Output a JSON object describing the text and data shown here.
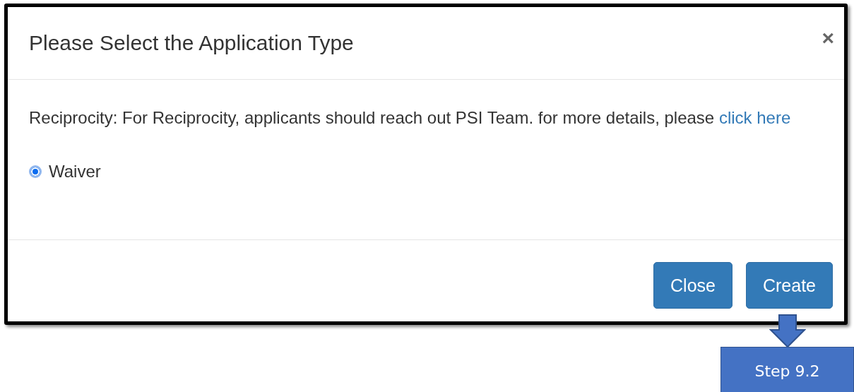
{
  "dialog": {
    "title": "Please Select the Application Type",
    "close": "×",
    "message": {
      "text": "Reciprocity: For Reciprocity, applicants should reach out PSI Team. for more details, please",
      "link": "click here"
    },
    "options": [
      {
        "label": "Waiver",
        "selected": true
      }
    ],
    "buttons": [
      {
        "label": "Close"
      },
      {
        "label": "Create"
      }
    ]
  },
  "callout": {
    "text": "Step 9.2"
  }
}
